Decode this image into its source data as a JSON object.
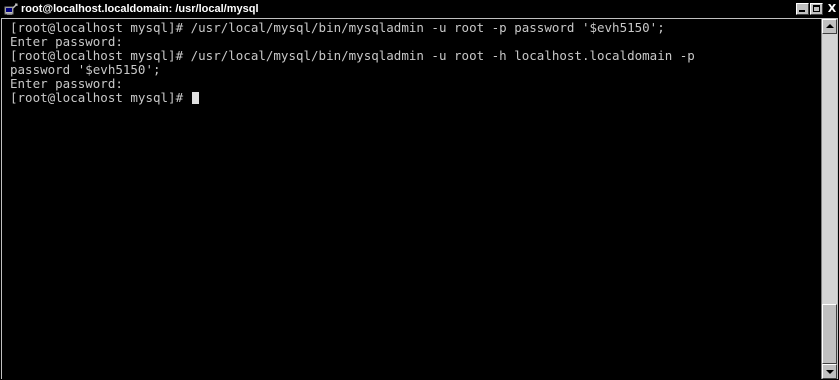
{
  "window": {
    "title": "root@localhost.localdomain: /usr/local/mysql",
    "icon": "terminal-session-icon",
    "controls": {
      "minimize_icon": "minimize-icon",
      "maximize_icon": "maximize-icon",
      "close_label": "X"
    }
  },
  "terminal": {
    "background": "#000000",
    "foreground": "#c8c8c8",
    "lines": [
      "[root@localhost mysql]# /usr/local/mysql/bin/mysqladmin -u root -p password '$evh5150';",
      "Enter password:",
      "[root@localhost mysql]# /usr/local/mysql/bin/mysqladmin -u root -h localhost.localdomain -p",
      "password '$evh5150';",
      "Enter password:"
    ],
    "prompt": "[root@localhost mysql]# "
  }
}
